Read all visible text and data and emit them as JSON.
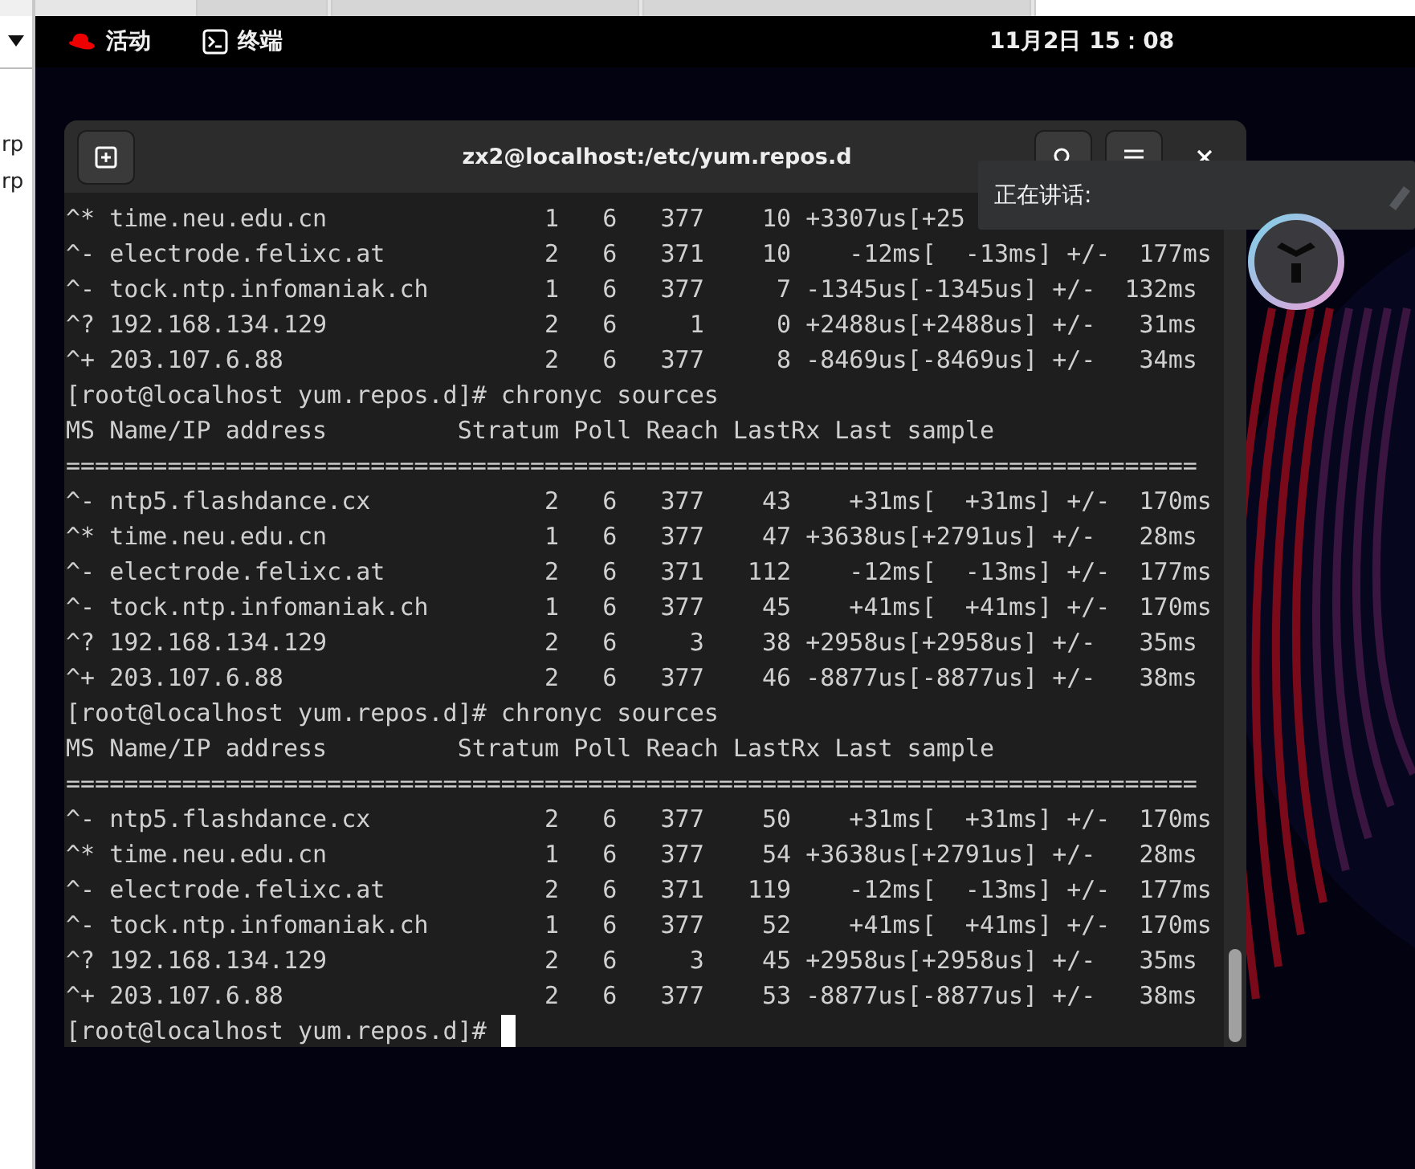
{
  "host_window": {
    "side_texts": [
      "rp",
      "rp"
    ],
    "tabs": [
      {
        "selected": false
      },
      {
        "selected": false
      },
      {
        "selected": false
      },
      {
        "selected": true
      }
    ]
  },
  "top_bar": {
    "activities": "活动",
    "app": "终端",
    "clock": "11月2日 15：08"
  },
  "terminal": {
    "title": "zx2@localhost:/etc/yum.repos.d",
    "lines": [
      "^* time.neu.edu.cn               1   6   377    10 +3307us[+25",
      "^- electrode.felixc.at           2   6   371    10    -12ms[  -13ms] +/-  177ms",
      "^- tock.ntp.infomaniak.ch        1   6   377     7 -1345us[-1345us] +/-  132ms",
      "^? 192.168.134.129               2   6     1     0 +2488us[+2488us] +/-   31ms",
      "^+ 203.107.6.88                  2   6   377     8 -8469us[-8469us] +/-   34ms",
      "[root@localhost yum.repos.d]# chronyc sources",
      "MS Name/IP address         Stratum Poll Reach LastRx Last sample",
      "==============================================================================",
      "^- ntp5.flashdance.cx            2   6   377    43    +31ms[  +31ms] +/-  170ms",
      "^* time.neu.edu.cn               1   6   377    47 +3638us[+2791us] +/-   28ms",
      "^- electrode.felixc.at           2   6   371   112    -12ms[  -13ms] +/-  177ms",
      "^- tock.ntp.infomaniak.ch        1   6   377    45    +41ms[  +41ms] +/-  170ms",
      "^? 192.168.134.129               2   6     3    38 +2958us[+2958us] +/-   35ms",
      "^+ 203.107.6.88                  2   6   377    46 -8877us[-8877us] +/-   38ms",
      "[root@localhost yum.repos.d]# chronyc sources",
      "MS Name/IP address         Stratum Poll Reach LastRx Last sample",
      "==============================================================================",
      "^- ntp5.flashdance.cx            2   6   377    50    +31ms[  +31ms] +/-  170ms",
      "^* time.neu.edu.cn               1   6   377    54 +3638us[+2791us] +/-   28ms",
      "^- electrode.felixc.at           2   6   371   119    -12ms[  -13ms] +/-  177ms",
      "^- tock.ntp.infomaniak.ch        1   6   377    52    +41ms[  +41ms] +/-  170ms",
      "^? 192.168.134.129               2   6     3    45 +2958us[+2958us] +/-   35ms",
      "^+ 203.107.6.88                  2   6   377    53 -8877us[-8877us] +/-   38ms"
    ],
    "prompt": "[root@localhost yum.repos.d]# "
  },
  "speaking_popup": {
    "label": "正在讲话:"
  }
}
